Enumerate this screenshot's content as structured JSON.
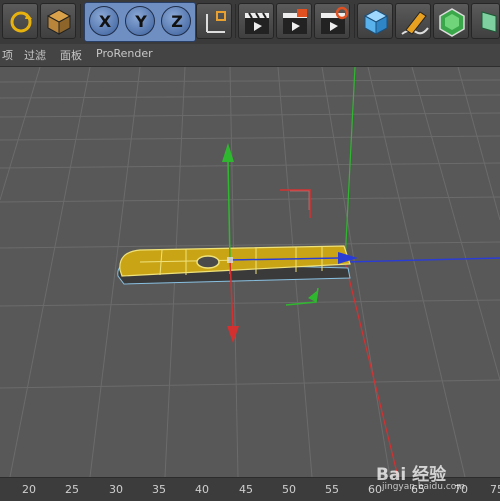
{
  "toolbar": {
    "axis_x": "X",
    "axis_y": "Y",
    "axis_z": "Z"
  },
  "menu": {
    "item_cut": "项",
    "item_filter": "过滤",
    "item_panel": "面板",
    "item_prorender": "ProRender"
  },
  "ruler": {
    "labels": [
      "20",
      "25",
      "30",
      "35",
      "40",
      "45",
      "50",
      "55",
      "60",
      "65",
      "70",
      "75"
    ]
  },
  "watermark": {
    "brand": "Bai 经验",
    "url": "jingyan.baidu.com"
  },
  "colors": {
    "axis_x": "#2a3cd6",
    "axis_y": "#2fb82f",
    "axis_z": "#d43030",
    "object_fill": "#c9a515",
    "object_edge": "#f0e27a",
    "viewport_bg": "#585858",
    "grid_line": "#6b6b6b"
  },
  "icons": [
    "refresh-icon",
    "cube-icon",
    "coordinate-axes-icon",
    "render-clapper-icon",
    "render-picture-icon",
    "render-settings-icon",
    "cube-primitive-icon",
    "pen-spline-icon",
    "subdivision-icon",
    "deformer-icon"
  ]
}
